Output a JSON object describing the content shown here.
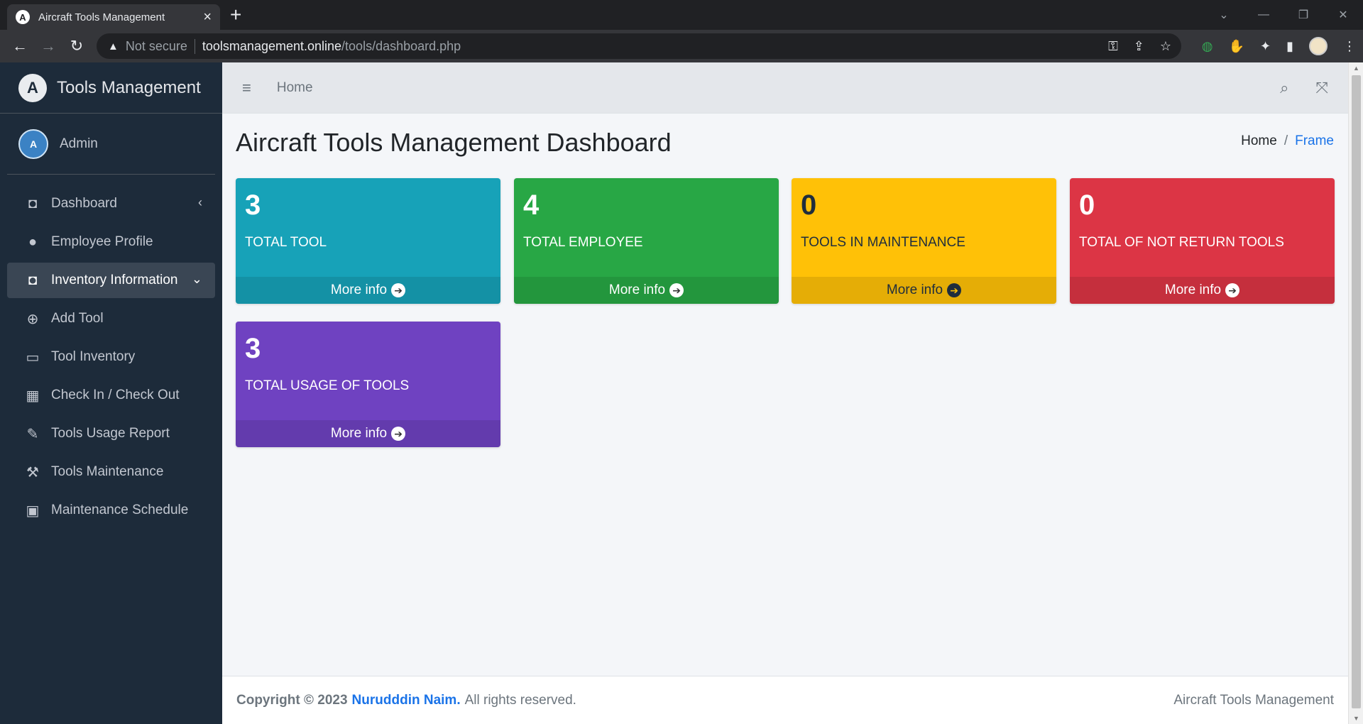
{
  "browser": {
    "tab_title": "Aircraft Tools Management",
    "favicon_letter": "A",
    "security_label": "Not secure",
    "url_host": "toolsmanagement.online",
    "url_path": "/tools/dashboard.php"
  },
  "sidebar": {
    "brand": "Tools Management",
    "brand_logo_letter": "A",
    "user_name": "Admin",
    "user_initials": "A",
    "items": [
      {
        "label": "Dashboard",
        "icon": "tachometer-icon"
      },
      {
        "label": "Employee Profile",
        "icon": "users-icon"
      },
      {
        "label": "Inventory Information",
        "icon": "inventory-icon"
      },
      {
        "label": "Add Tool",
        "icon": "plus-circle-icon"
      },
      {
        "label": "Tool Inventory",
        "icon": "laptop-icon"
      },
      {
        "label": "Check In / Check Out",
        "icon": "qrcode-icon"
      },
      {
        "label": "Tools Usage Report",
        "icon": "edit-icon"
      },
      {
        "label": "Tools Maintenance",
        "icon": "wrench-icon"
      },
      {
        "label": "Maintenance Schedule",
        "icon": "calendar-icon"
      }
    ]
  },
  "navbar": {
    "home_link": "Home"
  },
  "header": {
    "title": "Aircraft Tools Management Dashboard",
    "breadcrumb_home": "Home",
    "breadcrumb_current": "Frame"
  },
  "stats": [
    {
      "value": "3",
      "label": "TOTAL TOOL",
      "link": "More info",
      "color": "#17a2b8"
    },
    {
      "value": "4",
      "label": "TOTAL EMPLOYEE",
      "link": "More info",
      "color": "#28a745"
    },
    {
      "value": "0",
      "label": "TOOLS IN MAINTENANCE",
      "link": "More info",
      "color": "#ffc107"
    },
    {
      "value": "0",
      "label": "TOTAL OF NOT RETURN TOOLS",
      "link": "More info",
      "color": "#dc3545"
    },
    {
      "value": "3",
      "label": "TOTAL USAGE OF TOOLS",
      "link": "More info",
      "color": "#6f42c1"
    }
  ],
  "footer": {
    "copyright": "Copyright © 2023",
    "author": "Nurudddin Naim.",
    "rights": "All rights reserved.",
    "right_text": "Aircraft Tools Management"
  }
}
